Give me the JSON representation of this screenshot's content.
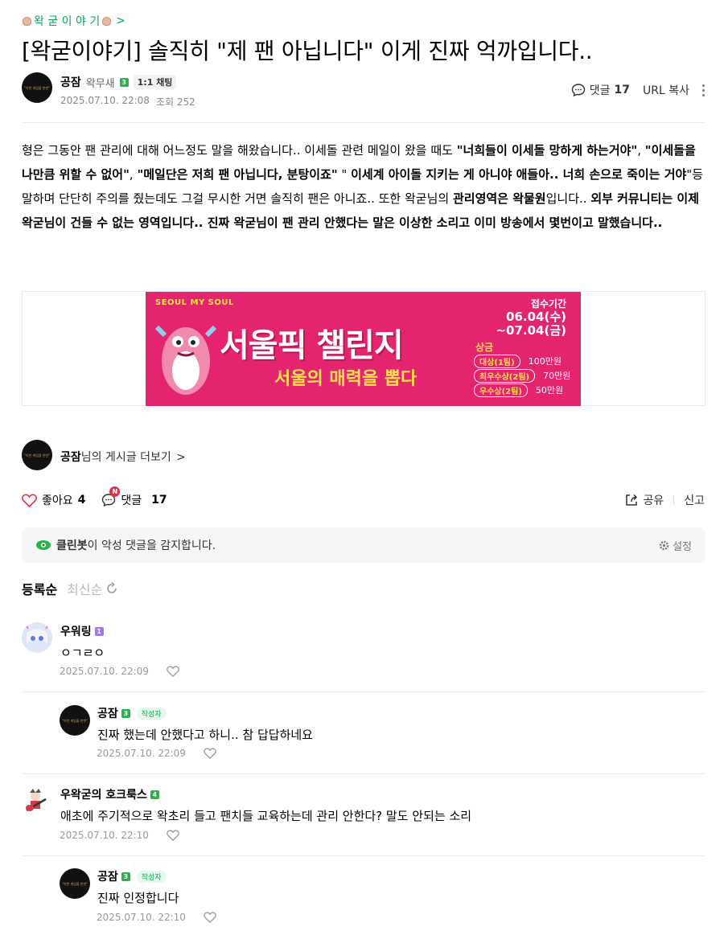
{
  "header": {
    "cafe_link": "왁 굳 이 야 기",
    "cafe_chevron": ">",
    "title": "[왁굳이야기] 솔직히 \"제 팬 아닙니다\" 이게 진짜 억까입니다..",
    "author": {
      "name": "공잠",
      "grade": "왁무새",
      "level": "3",
      "chat_label": "1:1 채팅",
      "avatar_text": "\"이번 게임을 한번\""
    },
    "date": "2025.07.10. 22:08",
    "views": "조회 252",
    "comment_label": "댓글",
    "comment_count": "17",
    "url_copy": "URL 복사"
  },
  "body": {
    "p1": "형은 그동안 팬 관리에 대해 어느정도 말을 해왔습니다.. 이세돌 관련 메일이 왔을 때도 ",
    "b1": "\"너희들이 이세돌 망하게 하는거야\"",
    "p2": ", ",
    "b2": "\"이세돌을 나만큼 위할 수 없어\"",
    "p3": ", ",
    "b3": "\"메일단은 저희 팬 아닙니다, 분탕이죠\"",
    "p4": " \" ",
    "b4": "이세계 아이돌 지키는 게 아니야 애들아.. 너희 손으로 죽이는 거야",
    "p5": "\"등 말하며 단단히 주의를 줬는데도 그걸 무시한 거면 솔직히 팬은 아니죠.. 또한 왁굳님의 ",
    "b5": "관리영역은 왁물원",
    "p6": "입니다.. ",
    "b6": "외부 커뮤니티는 이제 왁굳님이 건들 수 없는 영역입니다.. 진짜 왁굳님이 팬 관리 안했다는 말은 이상한 소리고 이미 방송에서 몇번이고 말했습니다.."
  },
  "banner": {
    "brand": "SEOUL MY SOUL",
    "headline": "서울픽 챌린지",
    "sub": "서울의 매력을 뽑다",
    "period_label": "접수기간",
    "period_start": "06.04(수)",
    "period_end": "~07.04(금)",
    "prize_label": "상금",
    "prizes": [
      {
        "label": "대상(1팀)",
        "amount": "100만원"
      },
      {
        "label": "최우수상(2팀)",
        "amount": "70만원"
      },
      {
        "label": "우수상(2팀)",
        "amount": "50만원"
      }
    ]
  },
  "more": {
    "name": "공잠",
    "suffix": "님의 게시글 더보기",
    "chevron": ">"
  },
  "reactions": {
    "like_label": "좋아요",
    "like_count": "4",
    "comment_label": "댓글",
    "comment_count": "17",
    "new_badge": "N",
    "share": "공유",
    "report": "신고"
  },
  "cleanbot": {
    "name": "클린봇",
    "message": "이 악성 댓글을 감지합니다.",
    "setting": "설정"
  },
  "sort": {
    "active": "등록순",
    "inactive": "최신순"
  },
  "comments": [
    {
      "name": "우워링",
      "level": "1",
      "text": "ㅇㄱㄹㅇ",
      "date": "2025.07.10. 22:09"
    },
    {
      "name": "공잠",
      "level": "3",
      "badge": "작성자",
      "text": "진짜 했는데 안했다고 하니.. 참 답답하네요",
      "date": "2025.07.10. 22:09"
    },
    {
      "name": "우왁굳의 호크룩스",
      "level": "4",
      "text": "애초에 주기적으로 왁초리 들고 팬치들 교육하는데 관리 안한다? 말도 안되는 소리",
      "date": "2025.07.10. 22:10"
    },
    {
      "name": "공잠",
      "level": "3",
      "badge": "작성자",
      "text": "진짜 인정합니다",
      "date": "2025.07.10. 22:10"
    }
  ],
  "colors": {
    "accent": "#03a94f",
    "banner_bg": "#e5246f",
    "like_red": "#e0334a"
  }
}
